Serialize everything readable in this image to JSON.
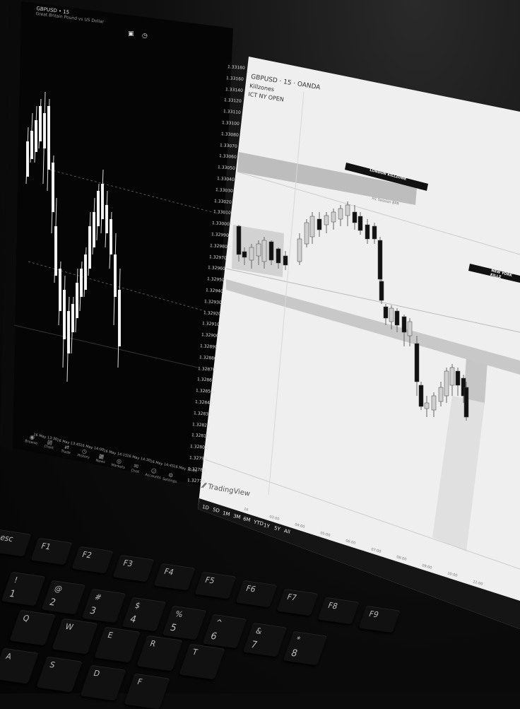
{
  "left_chart": {
    "symbol": "GBPUSD • 15",
    "description": "Great Britain Pound vs US Dollar",
    "price_labels": [
      "1.33180",
      "1.33160",
      "1.33140",
      "1.33120",
      "1.33110",
      "1.33100",
      "1.33080",
      "1.33070",
      "1.33060",
      "1.33050",
      "1.33040",
      "1.33030",
      "1.33020",
      "1.33010",
      "1.33000",
      "1.32990",
      "1.32980",
      "1.32970",
      "1.32960",
      "1.32950",
      "1.32940",
      "1.32930",
      "1.32920",
      "1.32910",
      "1.32900",
      "1.32890",
      "1.32880",
      "1.32870",
      "1.32860",
      "1.32850",
      "1.32840",
      "1.32830",
      "1.32820",
      "1.32810",
      "1.32800",
      "1.32790",
      "1.32780",
      "1.32770"
    ],
    "time_labels": [
      "16 May 13:30",
      "16 May 13:45",
      "16 May 14:00",
      "16 May 14:15",
      "16 May 14:30",
      "16 May 14:45",
      "16 May 15:00"
    ],
    "bottom_tabs": [
      "Browse",
      "Chart",
      "Trade",
      "History",
      "News",
      "Markets",
      "Chat",
      "Accounts",
      "Settings"
    ]
  },
  "right_chart": {
    "header": "GBPUSD · 15 · OANDA",
    "indicator": "Killzones",
    "session": "ICT NY OPEN",
    "zone_labels": [
      "LONDON KILLZONE",
      "NEW YORK KILLZ"
    ],
    "fvg_label": "H1 Session BPR",
    "brand": "TradingView",
    "timeframes": [
      "1D",
      "5D",
      "1M",
      "3M",
      "6M",
      "YTD",
      "1Y",
      "5Y",
      "All"
    ],
    "time_labels": [
      "16",
      "03:00",
      "04:00",
      "05:00",
      "06:00",
      "07:00",
      "08:00",
      "09:00",
      "10:00",
      "11:00"
    ]
  },
  "keyboard": {
    "row0": [
      "esc",
      "F1",
      "F2",
      "F3",
      "F4",
      "F5",
      "F6",
      "F7",
      "F8",
      "F9"
    ],
    "row1": [
      "!",
      "@",
      "#",
      "$",
      "%",
      "^",
      "&",
      "*"
    ],
    "row1_num": [
      "1",
      "2",
      "3",
      "4",
      "5",
      "6",
      "7",
      "8"
    ],
    "row2": [
      "Q",
      "W",
      "E",
      "R",
      "T"
    ],
    "row3": [
      "A",
      "S",
      "D",
      "F"
    ]
  }
}
